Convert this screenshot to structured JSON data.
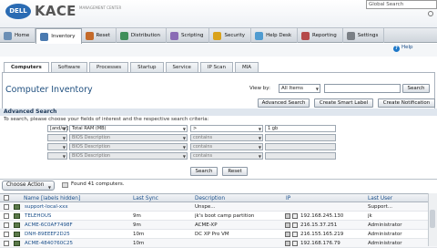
{
  "brand": {
    "logo": "DELL",
    "product": "KACE",
    "tagline": "MANAGEMENT CENTER"
  },
  "global_search": {
    "placeholder": "Global Search"
  },
  "nav": [
    {
      "label": "Home",
      "icon": "home-icon",
      "color": "#6b8fb5"
    },
    {
      "label": "Inventory",
      "icon": "inventory-icon",
      "color": "#4a7ab0",
      "active": true
    },
    {
      "label": "Reset",
      "icon": "reset-icon",
      "color": "#c46a2a"
    },
    {
      "label": "Distribution",
      "icon": "distribution-icon",
      "color": "#3f8f5a"
    },
    {
      "label": "Scripting",
      "icon": "scripting-icon",
      "color": "#8a6bb5"
    },
    {
      "label": "Security",
      "icon": "security-icon",
      "color": "#d9a21b"
    },
    {
      "label": "Help Desk",
      "icon": "helpdesk-icon",
      "color": "#4f9bd0"
    },
    {
      "label": "Reporting",
      "icon": "reporting-icon",
      "color": "#b54a4a"
    },
    {
      "label": "Settings",
      "icon": "settings-icon",
      "color": "#7a7f85"
    }
  ],
  "help_label": "Help",
  "tabs": [
    "Computers",
    "Software",
    "Processes",
    "Startup",
    "Service",
    "IP Scan",
    "MIA"
  ],
  "page_title": "Computer Inventory",
  "view_by": {
    "label": "View by:",
    "value": "All Items"
  },
  "search_button": "Search",
  "action_links": [
    "Advanced Search",
    "Create Smart Label",
    "Create Notification"
  ],
  "advanced_search": {
    "title": "Advanced Search",
    "description": "To search, please choose your fields of interest and the respective search criteria:",
    "rows": [
      {
        "conj": "[and/or]",
        "field": "Total RAM (MB)",
        "op": ">",
        "value": "1 gb",
        "disabled": false
      },
      {
        "conj": "",
        "field": "BIOS Description",
        "op": "contains",
        "value": "",
        "disabled": true
      },
      {
        "conj": "",
        "field": "BIOS Description",
        "op": "contains",
        "value": "",
        "disabled": true
      },
      {
        "conj": "",
        "field": "BIOS Description",
        "op": "contains",
        "value": "",
        "disabled": true
      }
    ],
    "search_btn": "Search",
    "reset_btn": "Reset"
  },
  "choose_action": "Choose Action",
  "found_text": "Found 41 computers.",
  "columns": [
    "Name [labels hidden]",
    "Last Sync",
    "Description",
    "IP",
    "Last User"
  ],
  "rows": [
    {
      "name": "support-local-xxx",
      "sync": "",
      "desc": "Unspe...",
      "ip": "",
      "user": "Support..."
    },
    {
      "name": "TELEHOUS",
      "sync": "9m",
      "desc": "jk's boot camp partition",
      "ip": "192.168.245.130",
      "user": "jk"
    },
    {
      "name": "ACME-6C0AF7498F",
      "sync": "9m",
      "desc": "ACME-XP",
      "ip": "216.15.37.251",
      "user": "Administrator"
    },
    {
      "name": "DNH-89EEEF2D25",
      "sync": "10m",
      "desc": "DC XP Pro VM",
      "ip": "216.155.165.219",
      "user": "Administrator"
    },
    {
      "name": "ACME-4840760C25",
      "sync": "10m",
      "desc": "",
      "ip": "192.168.176.79",
      "user": "Administrator"
    }
  ]
}
